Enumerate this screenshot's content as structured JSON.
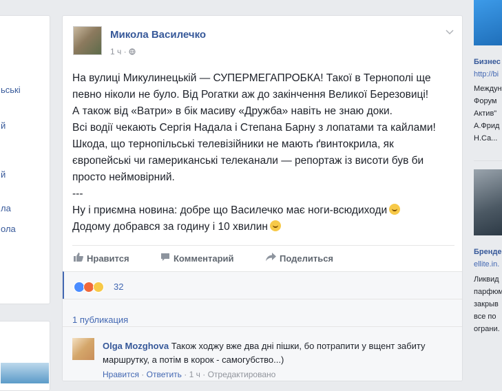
{
  "left_sidebar": {
    "items": [
      "ьські",
      "й",
      "й",
      "ла",
      "ола"
    ]
  },
  "post": {
    "author": "Микола Василечко",
    "time": "1 ч",
    "privacy_icon": "globe-icon",
    "text_lines": [
      "На вулиці Микулинецькій — СУПЕРМЕГАПРОБКА! Такої в Тернополі ще",
      "певно ніколи не було. Від Рогатки аж до закінчення Великої Березовиці!",
      "А також від «Ватри» в бік масиву «Дружба» навіть не знаю доки.",
      "Всі водії чекають Сергія Надала і Степана Барну з лопатами та кайлами!",
      "Шкода, що тернопільські телевізійники не мають ґвинтокрила, як",
      "європейські чи гамериканські телеканали — репортаж із висоти був би",
      "просто неймовірний.",
      "---",
      "Ну і приємна новина: добре що Василечко має ноги-всюдиходи",
      "Додому добрався за годину і 10 хвилин"
    ],
    "actions": {
      "like": "Нравится",
      "comment": "Комментарий",
      "share": "Поделиться"
    },
    "reactions_count": "32",
    "shares_text": "1 публикация",
    "comment": {
      "author": "Olga Mozghova",
      "text": "Також ходжу вже два дні пішки, бо потрапити у вщент забиту маршрутку, а потім в корок - самогубство...)",
      "reply_like": "Нравится",
      "reply": "Ответить",
      "time": "1 ч",
      "edited": "Отредактировано"
    }
  },
  "right_sidebar": {
    "ad1": {
      "title": "Бизнес",
      "url": "http://bi",
      "text_lines": [
        "Междун",
        "Форум",
        "Актив\"",
        "А.Фрид",
        "Н.Са..."
      ]
    },
    "ad2": {
      "title": "Бренде",
      "url": "ellite.in.",
      "text_lines": [
        "Ликвид",
        "парфюм",
        "закрыв",
        "все по",
        "ограни."
      ]
    }
  },
  "colors": {
    "link": "#365899",
    "accent": "#4267b2",
    "like_reaction": "#4a8cff",
    "angry_reaction": "#f0683a",
    "sad_reaction": "#f7c948"
  }
}
